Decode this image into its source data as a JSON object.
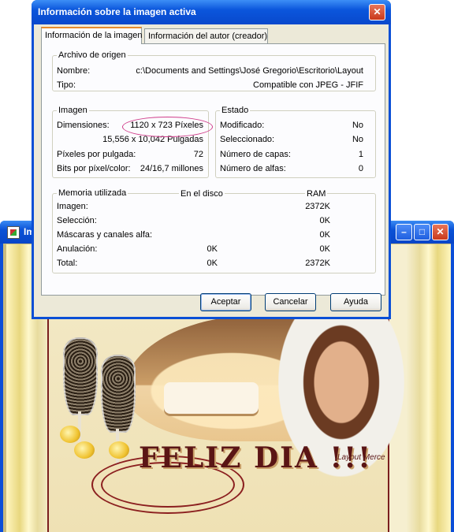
{
  "background_window": {
    "title": "Im",
    "buttons": {
      "minimize": "–",
      "maximize": "□",
      "close": "✕"
    },
    "image": {
      "greeting": "FELIZ DIA !!!",
      "signature": "Layout Merce"
    }
  },
  "dialog": {
    "title": "Información sobre la imagen activa",
    "close_glyph": "✕",
    "tabs": [
      {
        "label": "Información de la imagen",
        "active": true
      },
      {
        "label": "Información del autor (creador)",
        "active": false
      }
    ],
    "source": {
      "legend": "Archivo de origen",
      "name_label": "Nombre:",
      "name_value": "c:\\Documents and Settings\\José Gregorio\\Escritorio\\Layout",
      "type_label": "Tipo:",
      "type_value": "Compatible con JPEG - JFIF"
    },
    "image": {
      "legend": "Imagen",
      "dimensions_label": "Dimensiones:",
      "dimensions_pixels": "1120 x 723 Píxeles",
      "dimensions_inches": "15,556 x 10,042 Pulgadas",
      "ppi_label": "Píxeles por pulgada:",
      "ppi_value": "72",
      "bpp_label": "Bits por píxel/color:",
      "bpp_value": "24/16,7 millones"
    },
    "status": {
      "legend": "Estado",
      "modified_label": "Modificado:",
      "modified_value": "No",
      "selected_label": "Seleccionado:",
      "selected_value": "No",
      "layers_label": "Número de capas:",
      "layers_value": "1",
      "alphas_label": "Número de alfas:",
      "alphas_value": "0"
    },
    "memory": {
      "legend": "Memoria utilizada",
      "col_disk": "En el disco",
      "col_ram": "RAM",
      "rows": [
        {
          "label": "Imagen:",
          "disk": "",
          "ram": "2372K"
        },
        {
          "label": "Selección:",
          "disk": "",
          "ram": "0K"
        },
        {
          "label": "Máscaras y canales alfa:",
          "disk": "",
          "ram": "0K"
        },
        {
          "label": "Anulación:",
          "disk": "0K",
          "ram": "0K"
        },
        {
          "label": "Total:",
          "disk": "0K",
          "ram": "2372K"
        }
      ]
    },
    "buttons": {
      "ok": "Aceptar",
      "cancel": "Cancelar",
      "help": "Ayuda"
    }
  },
  "colors": {
    "xp_title_blue": "#0a52d6",
    "dialog_face": "#ece9d8",
    "annotation_oval": "#d03c8a"
  }
}
